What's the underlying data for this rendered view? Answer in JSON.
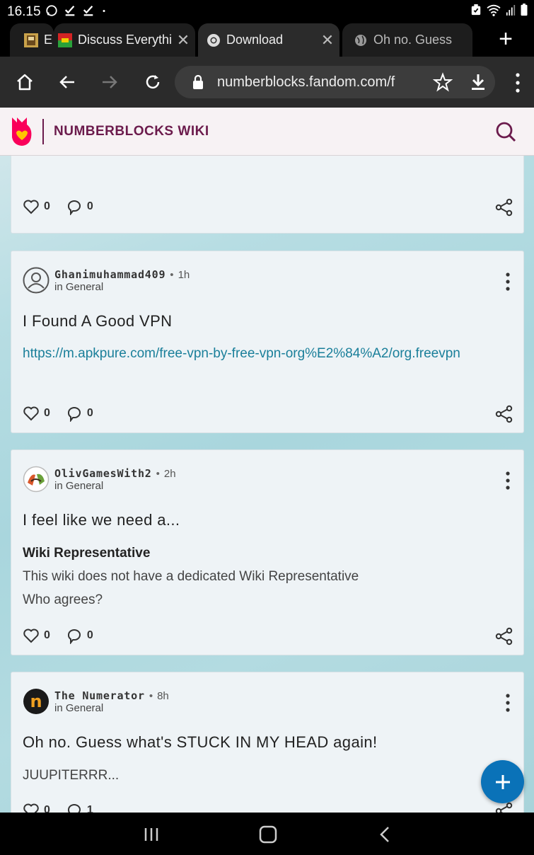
{
  "status_bar": {
    "time": "16.15",
    "left_icons": [
      "whatsapp-icon",
      "check-icon",
      "check-icon",
      "dot-icon"
    ],
    "right_icons": [
      "alarm-icon",
      "wifi-icon",
      "signal-icon",
      "battery-icon"
    ]
  },
  "tabs": [
    {
      "title": "E",
      "favicon": "game-favicon-icon",
      "active": false
    },
    {
      "title": "Discuss Everything",
      "favicon": "flag-favicon-icon",
      "active": false
    },
    {
      "title": "Download",
      "favicon": "chrome-favicon-icon",
      "active": true
    },
    {
      "title": "Oh no. Guess",
      "favicon": "globe-favicon-icon",
      "active": false
    }
  ],
  "toolbar": {
    "url": "numberblocks.fandom.com/f"
  },
  "wiki": {
    "title": "NUMBERBLOCKS WIKI"
  },
  "posts": [
    {
      "partial": true,
      "likes": "0",
      "comments": "0"
    },
    {
      "author": "Ghanimuhammad409",
      "time": "1h",
      "category": "in General",
      "title": "I Found A Good VPN",
      "link": "https://m.apkpure.com/free-vpn-by-free-vpn-org%E2%84%A2/org.freevpn",
      "likes": "0",
      "comments": "0"
    },
    {
      "author": "OlivGamesWith2",
      "time": "2h",
      "category": "in General",
      "title": "I feel like we need a...",
      "subheading": "Wiki Representative",
      "lines": [
        "This wiki does not have a dedicated Wiki Representative",
        "Who agrees?"
      ],
      "likes": "0",
      "comments": "0"
    },
    {
      "author": "The Numerator",
      "time": "8h",
      "category": "in General",
      "title": "Oh no. Guess what's STUCK IN MY HEAD again!",
      "lines": [
        "JUUPITERRR..."
      ],
      "likes": "0",
      "comments": "1"
    }
  ],
  "colors": {
    "wiki_accent": "#6b1b4c",
    "link": "#1a7f9a",
    "fab": "#0a72b8",
    "fandom_logo": "#fa005a"
  }
}
